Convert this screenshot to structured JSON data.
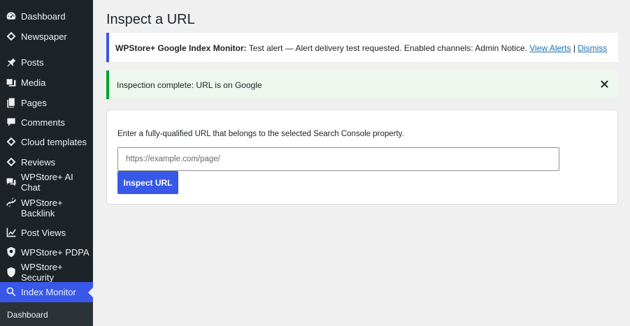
{
  "sidebar": {
    "items": [
      {
        "label": "Dashboard",
        "icon": "dashboard-icon"
      },
      {
        "label": "Newspaper",
        "icon": "newspaper-icon"
      },
      {
        "label": "Posts",
        "icon": "pushpin-icon"
      },
      {
        "label": "Media",
        "icon": "media-icon"
      },
      {
        "label": "Pages",
        "icon": "pages-icon"
      },
      {
        "label": "Comments",
        "icon": "comments-icon"
      },
      {
        "label": "Cloud templates",
        "icon": "cloud-templates-icon"
      },
      {
        "label": "Reviews",
        "icon": "reviews-icon"
      },
      {
        "label": "WPStore+ AI Chat",
        "icon": "ai-chat-icon"
      },
      {
        "label": "WPStore+ Backlink",
        "icon": "link-icon"
      },
      {
        "label": "Post Views",
        "icon": "chart-line-icon"
      },
      {
        "label": "WPStore+ PDPA",
        "icon": "pdpa-shield-icon"
      },
      {
        "label": "WPStore+ Security",
        "icon": "shield-icon"
      },
      {
        "label": "Index Monitor",
        "icon": "search-icon",
        "active": true
      }
    ],
    "submenu": {
      "label": "Dashboard"
    }
  },
  "main": {
    "title": "Inspect a URL",
    "alert_notice": {
      "strong": "WPStore+ Google Index Monitor:",
      "text": " Test alert — Alert delivery test requested. Enabled channels: Admin Notice. ",
      "link_view": "View Alerts",
      "separator": " | ",
      "link_dismiss": "Dismiss",
      "accent_color": "#3858e9"
    },
    "success_notice": {
      "text": "Inspection complete: URL is on Google",
      "accent_color": "#00a32a"
    },
    "form": {
      "description": "Enter a fully-qualified URL that belongs to the selected Search Console property.",
      "url_placeholder": "https://example.com/page/",
      "url_value": "",
      "submit_label": "Inspect URL",
      "button_color": "#3858e9"
    }
  }
}
